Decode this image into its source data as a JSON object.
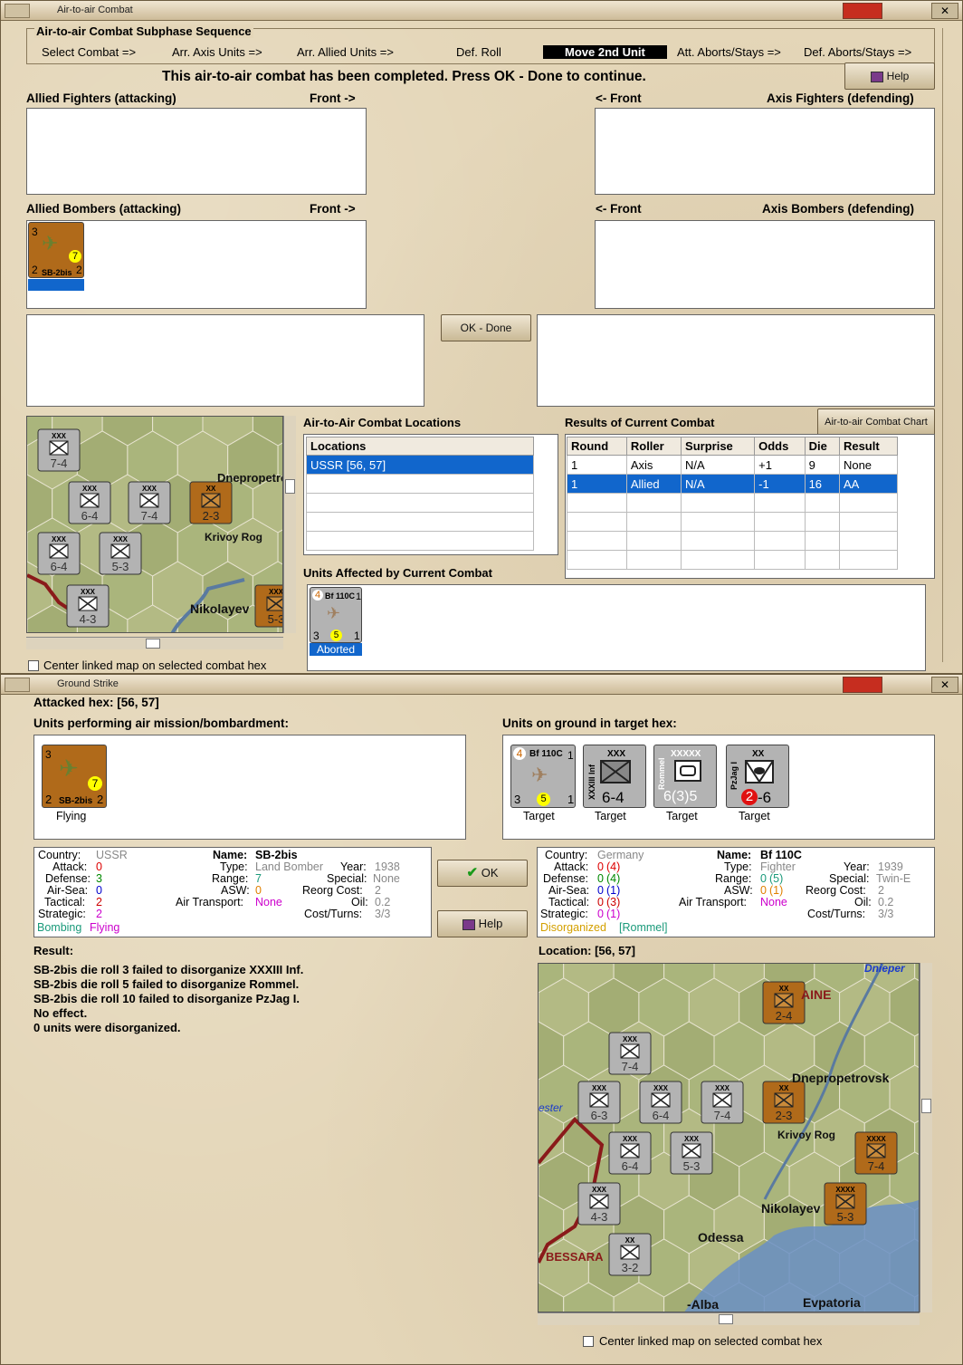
{
  "air_window": {
    "title": "Air-to-air Combat",
    "sequence_title": "Air-to-air Combat Subphase Sequence",
    "sequence": [
      "Select Combat =>",
      "Arr. Axis Units =>",
      "Arr. Allied Units =>",
      "Def. Roll",
      "Move 2nd Unit",
      "Att. Aborts/Stays =>",
      "Def. Aborts/Stays =>"
    ],
    "message": "This air-to-air combat has been completed.  Press OK - Done to continue.",
    "help_label": "Help",
    "allied_fighters_label": "Allied Fighters (attacking)",
    "front_right": "Front ->",
    "front_left": "<- Front",
    "axis_fighters_label": "Axis Fighters (defending)",
    "allied_bombers_label": "Allied Bombers (attacking)",
    "axis_bombers_label": "Axis Bombers (defending)",
    "ok_done_label": "OK - Done",
    "bomber_unit": {
      "name": "SB-2bis",
      "top_left": "3",
      "attack": "7",
      "bottom_left": "2",
      "bottom_right": "2"
    },
    "locations_title": "Air-to-Air Combat Locations",
    "locations_header": "Locations",
    "locations": [
      "USSR [56, 57]"
    ],
    "results_title": "Results of Current Combat",
    "chart_button": "Air-to-air Combat Chart",
    "results_headers": [
      "Round",
      "Roller",
      "Surprise",
      "Odds",
      "Die",
      "Result"
    ],
    "results_rows": [
      [
        "1",
        "Axis",
        "N/A",
        "+1",
        "9",
        "None"
      ],
      [
        "1",
        "Allied",
        "N/A",
        "-1",
        "16",
        "AA"
      ]
    ],
    "affected_title": "Units Affected by Current Combat",
    "affected_unit": {
      "name": "Bf 110C",
      "top_left": "4",
      "top_right": "1",
      "bottom_left": "3",
      "mid": "5",
      "bottom_right": "1",
      "status": "Aborted"
    },
    "center_map_label": "Center linked map on selected combat hex",
    "map_labels": {
      "dnepr": "Dnepropetrovsk",
      "krivoy": "Krivoy Rog",
      "nikolayev": "Nikolayev"
    },
    "map_counters": [
      {
        "num": "7-4",
        "type": "XXX"
      },
      {
        "num": "6-4",
        "type": "XXX"
      },
      {
        "num": "7-4",
        "type": "XXX"
      },
      {
        "num": "2-3",
        "type": "XX"
      },
      {
        "num": "6-4",
        "type": "XXX"
      },
      {
        "num": "5-3",
        "type": "XXX"
      },
      {
        "num": "4-3",
        "type": "XXX"
      },
      {
        "num": "5-3",
        "type": "XXX"
      }
    ]
  },
  "ground_window": {
    "title": "Ground Strike",
    "attacked_hex_label": "Attacked hex:  [56, 57]",
    "units_air_label": "Units performing air mission/bombardment:",
    "units_ground_label": "Units on ground in target hex:",
    "air_unit": {
      "name": "SB-2bis",
      "top_left": "3",
      "attack": "7",
      "bottom_left": "2",
      "bottom_right": "2",
      "status": "Flying"
    },
    "ground_units": [
      {
        "name": "Bf 110C",
        "top_left": "4",
        "top_right": "1",
        "bottom_left": "3",
        "mid": "5",
        "bottom_right": "1",
        "status": "Target"
      },
      {
        "name": "XXXIII Inf",
        "size": "XXX",
        "value": "6-4",
        "status": "Target"
      },
      {
        "name": "Rommel",
        "size": "XXXXX",
        "value": "6(3)5",
        "status": "Target"
      },
      {
        "name": "PzJag I",
        "size": "XX",
        "value_a": "2",
        "value_b": "-6",
        "status": "Target"
      }
    ],
    "left_info": {
      "country_k": "Country:",
      "country_v": "USSR",
      "attack_k": "Attack:",
      "attack_v": "0",
      "defense_k": "Defense:",
      "defense_v": "3",
      "airsea_k": "Air-Sea:",
      "airsea_v": "0",
      "tactical_k": "Tactical:",
      "tactical_v": "2",
      "strategic_k": "Strategic:",
      "strategic_v": "2",
      "name_k": "Name:",
      "name_v": "SB-2bis",
      "type_k": "Type:",
      "type_v": "Land Bomber",
      "year_k": "Year:",
      "year_v": "1938",
      "range_k": "Range:",
      "range_v": "7",
      "special_k": "Special:",
      "special_v": "None",
      "asw_k": "ASW:",
      "asw_v": "0",
      "reorg_k": "Reorg Cost:",
      "reorg_v": "2",
      "airtr_k": "Air Transport:",
      "airtr_v": "None",
      "oil_k": "Oil:",
      "oil_v": "0.2",
      "cost_k": "Cost/Turns:",
      "cost_v": "3/3",
      "status_a": "Bombing",
      "status_b": "Flying"
    },
    "ok_label": "OK",
    "help_label": "Help",
    "right_info": {
      "country_k": "Country:",
      "country_v": "Germany",
      "attack_k": "Attack:",
      "attack_v": "0",
      "attack_p": "(4)",
      "defense_k": "Defense:",
      "defense_v": "0",
      "defense_p": "(4)",
      "airsea_k": "Air-Sea:",
      "airsea_v": "0",
      "airsea_p": "(1)",
      "tactical_k": "Tactical:",
      "tactical_v": "0",
      "tactical_p": "(3)",
      "strategic_k": "Strategic:",
      "strategic_v": "0",
      "strategic_p": "(1)",
      "name_k": "Name:",
      "name_v": "Bf 110C",
      "type_k": "Type:",
      "type_v": "Fighter",
      "year_k": "Year:",
      "year_v": "1939",
      "range_k": "Range:",
      "range_v": "0",
      "range_p": "(5)",
      "special_k": "Special:",
      "special_v": "Twin-E",
      "asw_k": "ASW:",
      "asw_v": "0",
      "asw_p": "(1)",
      "reorg_k": "Reorg Cost:",
      "reorg_v": "2",
      "airtr_k": "Air Transport:",
      "airtr_v": "None",
      "oil_k": "Oil:",
      "oil_v": "0.2",
      "cost_k": "Cost/Turns:",
      "cost_v": "3/3",
      "status_a": "Disorganized",
      "status_b": "[Rommel]"
    },
    "result_label": "Result:",
    "result_lines": [
      "SB-2bis die roll 3 failed to disorganize XXXIII Inf.",
      "SB-2bis die roll 5 failed to disorganize Rommel.",
      "SB-2bis die roll 10 failed to disorganize PzJag I.",
      "No effect.",
      "0 units were disorganized."
    ],
    "location_label": "Location:   [56, 57]",
    "map_labels": {
      "dnieper": "Dnieper",
      "dnepr": "Dnepropetrovsk",
      "krivoy": "Krivoy Rog",
      "nikolayev": "Nikolayev",
      "odessa": "Odessa",
      "bessarabia": "BESSARA",
      "alba": "-Alba",
      "evpatoria": "Evpatoria",
      "ester": "ester",
      "aine": "AINE"
    },
    "map_counters": [
      {
        "num": "2-4",
        "type": "XX"
      },
      {
        "num": "7-4",
        "type": "XXX"
      },
      {
        "num": "6-3",
        "type": "XXX"
      },
      {
        "num": "6-4",
        "type": "XXX"
      },
      {
        "num": "7-4",
        "type": "XXX"
      },
      {
        "num": "2-3",
        "type": "XX"
      },
      {
        "num": "6-4",
        "type": "XXX"
      },
      {
        "num": "5-3",
        "type": "XXX"
      },
      {
        "num": "7-4",
        "type": "XXXX"
      },
      {
        "num": "4-3",
        "type": "XXX"
      },
      {
        "num": "3-2",
        "type": "XX"
      },
      {
        "num": "5-3",
        "type": "XXXX"
      }
    ],
    "center_map_label": "Center linked map on selected combat hex"
  },
  "colors": {
    "parchment": "#e4d6b8",
    "selection": "#1166cc",
    "soviet_counter": "#b06a1a",
    "german_counter": "#b3b3b3"
  }
}
